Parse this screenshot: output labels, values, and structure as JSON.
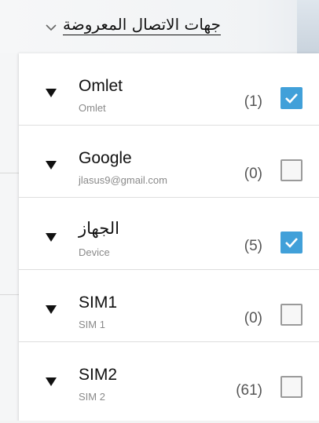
{
  "header": {
    "title": "جهات الاتصال المعروضة",
    "chevron_icon": "chevron-down-icon"
  },
  "accounts": [
    {
      "name": "Omlet",
      "sub": "Omlet",
      "count": "(1)",
      "checked": true,
      "expand_icon": "expand-triangle-icon"
    },
    {
      "name": "Google",
      "sub": "jlasus9@gmail.com",
      "count": "(0)",
      "checked": false,
      "expand_icon": "expand-triangle-icon"
    },
    {
      "name": "الجهاز",
      "sub": "Device",
      "count": "(5)",
      "checked": true,
      "expand_icon": "expand-triangle-icon"
    },
    {
      "name": "SIM1",
      "sub": "SIM 1",
      "count": "(0)",
      "checked": false,
      "expand_icon": "expand-triangle-icon"
    },
    {
      "name": "SIM2",
      "sub": "SIM 2",
      "count": "(61)",
      "checked": false,
      "expand_icon": "expand-triangle-icon"
    }
  ],
  "colors": {
    "accent": "#41a0d9",
    "selection_bar": "#1e9bd7"
  }
}
